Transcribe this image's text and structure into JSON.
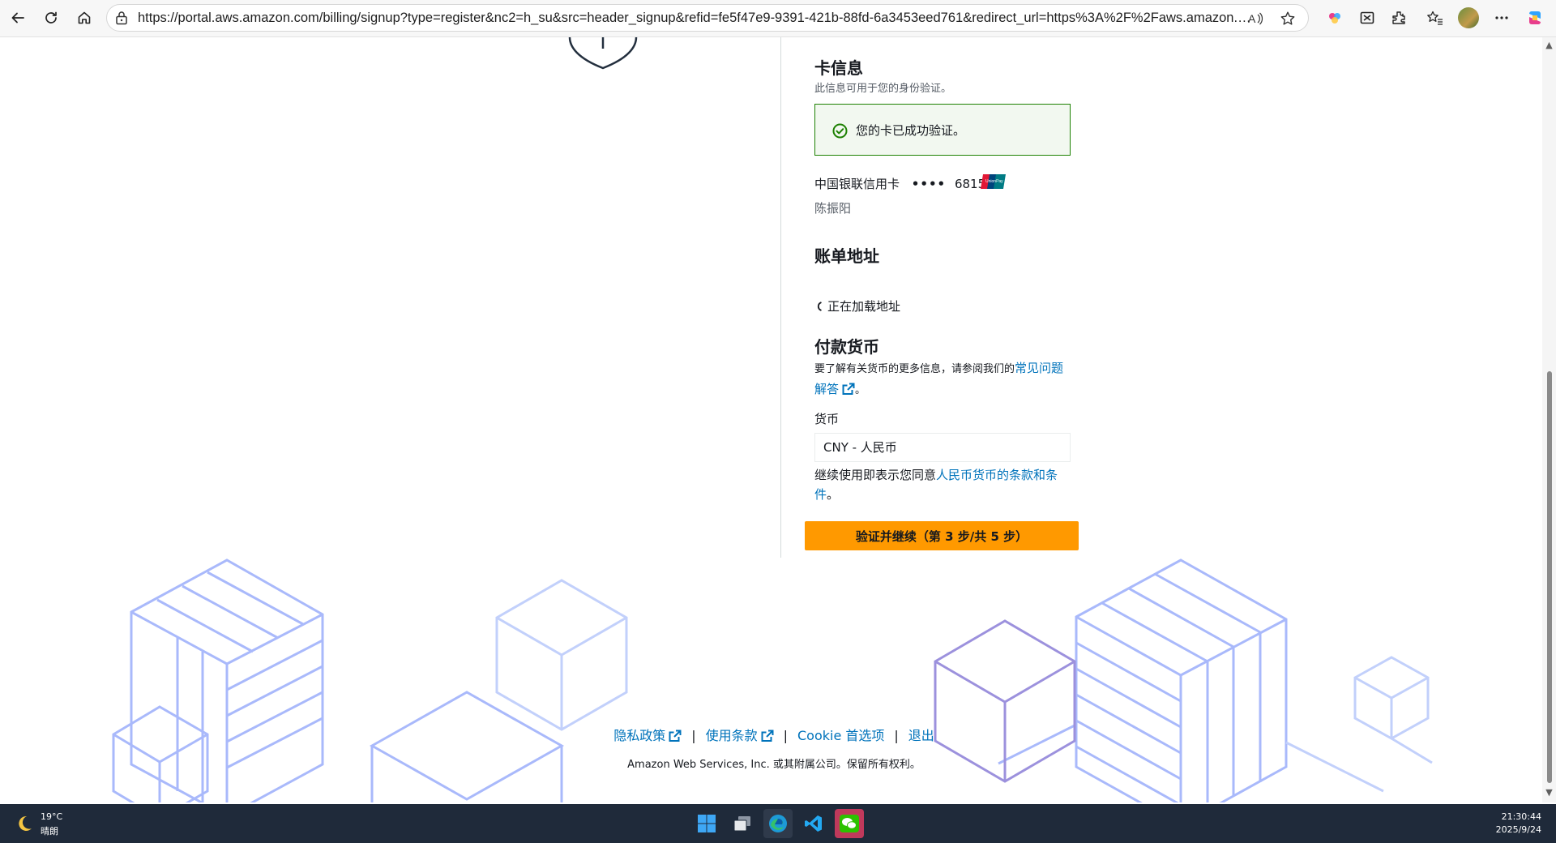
{
  "browser": {
    "url": "https://portal.aws.amazon.com/billing/signup?type=register&nc2=h_su&src=header_signup&refid=fe5f47e9-9391-421b-88fd-6a3453eed761&redirect_url=https%3A%2F%2Faws.amazon.com%2...",
    "icons": [
      "back-icon",
      "refresh-icon",
      "home-icon",
      "lock-icon",
      "read-aloud-icon",
      "favorite-star-icon",
      "copilot-extension-icon",
      "screen-capture-icon",
      "extensions-icon",
      "favorites-icon",
      "profile-avatar",
      "more-icon",
      "copilot-icon"
    ]
  },
  "card_info": {
    "title": "卡信息",
    "subtitle": "此信息可用于您的身份验证。",
    "success_message": "您的卡已成功验证。",
    "card_name": "中国银联信用卡",
    "card_mask": "••••",
    "card_last4": "6815",
    "card_brand_icon": "unionpay-logo",
    "card_holder": "陈振阳"
  },
  "billing_address": {
    "title": "账单地址",
    "loading_text": "正在加载地址"
  },
  "payment_currency": {
    "title": "付款货币",
    "desc_prefix": "要了解有关货币的更多信息，请参阅我们的",
    "faq_link": "常见问题解答",
    "desc_suffix": "。",
    "currency_label": "货币",
    "currency_value": "CNY - 人民币",
    "terms_prefix": "继续使用即表示您同意",
    "terms_link": "人民币货币的条款和条件",
    "terms_suffix": "。"
  },
  "submit_button": "验证并继续（第 3 步/共 5 步）",
  "footer": {
    "privacy": "隐私政策",
    "terms": "使用条款",
    "cookie": "Cookie 首选项",
    "logout": "退出",
    "separator": "|",
    "copyright": "Amazon Web Services, Inc. 或其附属公司。保留所有权利。"
  },
  "taskbar": {
    "temperature": "19°C",
    "condition": "晴朗",
    "time": "21:30:44",
    "date": "2025/9/24",
    "apps": [
      "windows-start-icon",
      "task-view-icon",
      "edge-icon",
      "vscode-icon",
      "wechat-icon"
    ]
  },
  "colors": {
    "primary_button": "#ff9900",
    "link": "#0073bb",
    "success_border": "#1d8102",
    "taskbar": "#1f2a3a"
  }
}
